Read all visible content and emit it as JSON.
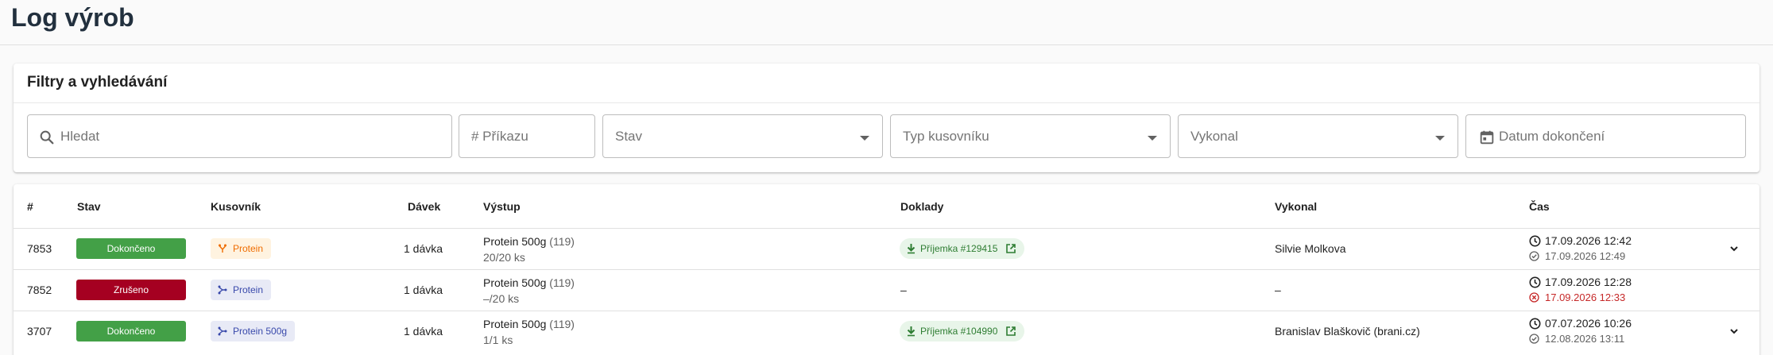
{
  "page": {
    "title": "Log výrob"
  },
  "filters": {
    "title": "Filtry a vyhledávání",
    "search_placeholder": "Hledat",
    "order_placeholder": "# Příkazu",
    "status_placeholder": "Stav",
    "bom_type_placeholder": "Typ kusovníku",
    "performer_placeholder": "Vykonal",
    "date_placeholder": "Datum dokončení"
  },
  "table": {
    "headers": {
      "id": "#",
      "status": "Stav",
      "bom": "Kusovník",
      "batches": "Dávek",
      "output": "Výstup",
      "documents": "Doklady",
      "performer": "Vykonal",
      "time": "Čas"
    },
    "rows": [
      {
        "id": "7853",
        "status": "Dokončeno",
        "status_color": "#43a047",
        "bom_label": "Protein",
        "bom_icon": "split-icon",
        "bom_bg": "#fff3e0",
        "bom_color": "#ef6c00",
        "batches": "1 dávka",
        "output_name": "Protein 500g",
        "output_code": "(119)",
        "output_qty": "20/20 ks",
        "document": "Příjemka #129415",
        "performer": "Silvie Molkova",
        "time_start": "17.09.2026 12:42",
        "time_end": "17.09.2026 12:49",
        "end_state": "done"
      },
      {
        "id": "7852",
        "status": "Zrušeno",
        "status_color": "#a50021",
        "bom_label": "Protein",
        "bom_icon": "merge-icon",
        "bom_bg": "#e8eaf6",
        "bom_color": "#3949ab",
        "batches": "1 dávka",
        "output_name": "Protein 500g",
        "output_code": "(119)",
        "output_qty": "–/20 ks",
        "document": "–",
        "performer": "–",
        "time_start": "17.09.2026 12:28",
        "time_end": "17.09.2026 12:33",
        "end_state": "cancelled"
      },
      {
        "id": "3707",
        "status": "Dokončeno",
        "status_color": "#43a047",
        "bom_label": "Protein 500g",
        "bom_icon": "merge-icon",
        "bom_bg": "#e8eaf6",
        "bom_color": "#3949ab",
        "batches": "1 dávka",
        "output_name": "Protein 500g",
        "output_code": "(119)",
        "output_qty": "1/1 ks",
        "document": "Příjemka #104990",
        "performer": "Branislav Blaškovič (brani.cz)",
        "time_start": "07.07.2026 10:26",
        "time_end": "12.08.2026 13:11",
        "end_state": "done"
      }
    ]
  }
}
